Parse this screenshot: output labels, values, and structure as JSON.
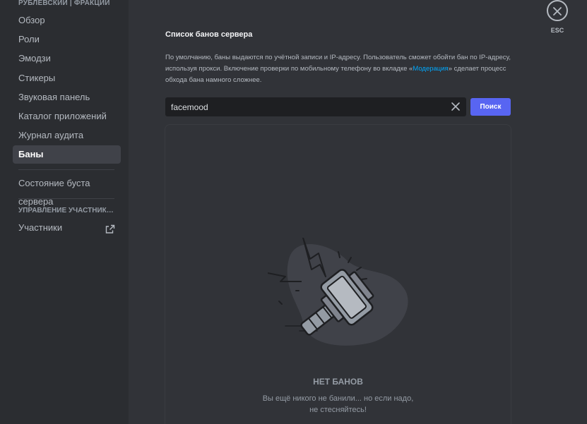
{
  "sidebar": {
    "header": "РУБЛЕВСКИЙ | ФРАКЦИИ",
    "items": [
      {
        "label": "Обзор"
      },
      {
        "label": "Роли"
      },
      {
        "label": "Эмодзи"
      },
      {
        "label": "Стикеры"
      },
      {
        "label": "Звуковая панель"
      },
      {
        "label": "Каталог приложений"
      },
      {
        "label": "Журнал аудита"
      },
      {
        "label": "Баны"
      }
    ],
    "boost_item": "Состояние буста сервера",
    "members_section": "УПРАВЛЕНИЕ УЧАСТНИКА...",
    "members_item": "Участники"
  },
  "main": {
    "title": "Список банов сервера",
    "desc_part1": "По умолчанию, баны выдаются по учётной записи и IP-адресу. Пользователь сможет обойти бан по IP-адресу, используя прокси. Включение проверки по мобильному телефону во вкладке «",
    "desc_link": "Модерация",
    "desc_part2": "» сделает процесс обхода бана намного сложнее.",
    "search_value": "facemood",
    "search_button": "Поиск",
    "empty_title": "НЕТ БАНОВ",
    "empty_line1": "Вы ещё никого не банили... но если надо,",
    "empty_line2": "не стесняйтесь!"
  },
  "close": {
    "label": "ESC"
  },
  "colors": {
    "accent": "#5865f2",
    "link": "#00a8fc",
    "background": "#313338",
    "sidebar": "#2b2d31"
  },
  "icons": [
    "close-icon",
    "clear-search-icon",
    "external-link-icon",
    "ban-hammer-illustration"
  ]
}
